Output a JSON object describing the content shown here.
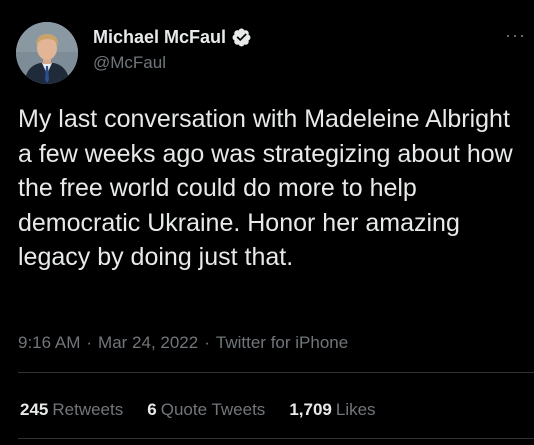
{
  "author": {
    "display_name": "Michael McFaul",
    "handle": "@McFaul",
    "verified": true,
    "avatar_icon": "profile-photo"
  },
  "tweet": {
    "text": "My last conversation with Madeleine Albright a few weeks ago was strategizing about how the free world could do more to help democratic Ukraine. Honor her amazing legacy by doing just that.",
    "time": "9:16 AM",
    "separator": "·",
    "date": "Mar 24, 2022",
    "source": "Twitter for iPhone"
  },
  "menu": {
    "more_icon": "more-horizontal-icon",
    "more_glyph": "···"
  },
  "stats": {
    "retweets": {
      "count": "245",
      "label": "Retweets"
    },
    "quote_tweets": {
      "count": "6",
      "label": "Quote Tweets"
    },
    "likes": {
      "count": "1,709",
      "label": "Likes"
    }
  },
  "colors": {
    "background": "#000000",
    "primary_text": "#e7e9ea",
    "secondary_text": "#71767b",
    "verified_badge": "#e7e9ea",
    "divider": "#2f3336"
  }
}
